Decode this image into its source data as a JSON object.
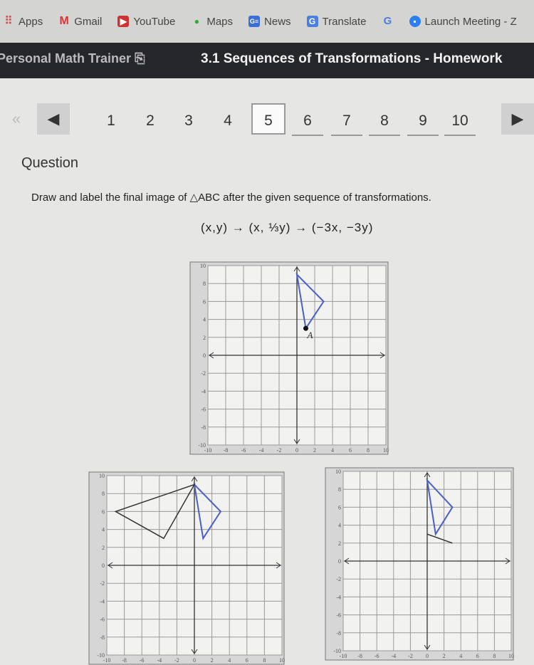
{
  "bookmarks": [
    {
      "label": "Apps",
      "icon": "apps-grid-icon"
    },
    {
      "label": "Gmail",
      "icon": "gmail-icon"
    },
    {
      "label": "YouTube",
      "icon": "youtube-icon"
    },
    {
      "label": "Maps",
      "icon": "maps-pin-icon"
    },
    {
      "label": "News",
      "icon": "news-icon"
    },
    {
      "label": "Translate",
      "icon": "translate-icon"
    },
    {
      "label": "",
      "icon": "google-icon"
    },
    {
      "label": "Launch Meeting - Z",
      "icon": "zoom-icon"
    }
  ],
  "header": {
    "app": "Personal Math Trainer",
    "title": "3.1 Sequences of Transformations - Homework"
  },
  "pager": {
    "pages": [
      "1",
      "2",
      "3",
      "4",
      "5",
      "6",
      "7",
      "8",
      "9",
      "10"
    ],
    "current": "5"
  },
  "question": {
    "label": "Question",
    "prompt": "Draw and label the final image of △ABC after the given sequence of transformations.",
    "formula": "(x,y) → (x, ⅓y) → (−3x, −3y)"
  },
  "graph": {
    "xlim": [
      -10,
      10
    ],
    "ylim": [
      -10,
      10
    ],
    "x_ticks": [
      "-10",
      "-8",
      "-6",
      "-4",
      "-2",
      "0",
      "2",
      "4",
      "6",
      "8",
      "10"
    ],
    "y_ticks": [
      "10",
      "8",
      "6",
      "4",
      "2",
      "0",
      "-2",
      "-4",
      "-6",
      "-8",
      "-10"
    ],
    "triangle": [
      [
        0,
        9
      ],
      [
        3,
        6
      ],
      [
        1,
        3
      ]
    ],
    "point_label": "A",
    "point": [
      1,
      3
    ],
    "color": "#4a5fc8"
  },
  "choices": [
    {
      "triangle_original": [
        [
          0,
          9
        ],
        [
          3,
          6
        ],
        [
          1,
          3
        ]
      ],
      "triangle_image": [
        [
          0,
          9
        ],
        [
          -9,
          6
        ],
        [
          -3.5,
          3
        ]
      ]
    },
    {
      "triangle_original": [
        [
          0,
          9
        ],
        [
          3,
          6
        ],
        [
          1,
          3
        ]
      ],
      "segment_image": [
        [
          0,
          3
        ],
        [
          3,
          2
        ]
      ]
    }
  ]
}
